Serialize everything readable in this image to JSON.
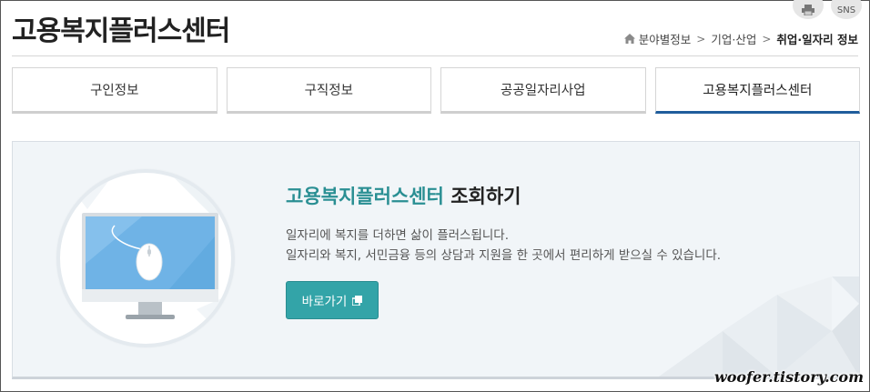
{
  "page": {
    "title": "고용복지플러스센터"
  },
  "top_icons": {
    "sns_label": "SNS"
  },
  "breadcrumb": {
    "items": [
      "분야별정보",
      "기업·산업",
      "취업·일자리 정보"
    ],
    "separator": ">"
  },
  "tabs": [
    {
      "label": "구인정보",
      "active": false
    },
    {
      "label": "구직정보",
      "active": false
    },
    {
      "label": "공공일자리사업",
      "active": false
    },
    {
      "label": "고용복지플러스센터",
      "active": true
    }
  ],
  "panel": {
    "title_accent": "고용복지플러스센터",
    "title_rest": " 조회하기",
    "desc_line1": "일자리에 복지를 더하면 삶이 플러스됩니다.",
    "desc_line2": "일자리와 복지, 서민금융 등의 상담과 지원을 한 곳에서 편리하게 받으실 수 있습니다.",
    "button_label": "바로가기"
  },
  "watermark": "woofer.tistory.com",
  "colors": {
    "accent_teal": "#2a8f93",
    "button_bg": "#33a4a8",
    "active_tab_underline": "#1f5d9c"
  },
  "icons": [
    "print-icon",
    "home-icon",
    "monitor-mouse-icon",
    "new-window-icon"
  ]
}
